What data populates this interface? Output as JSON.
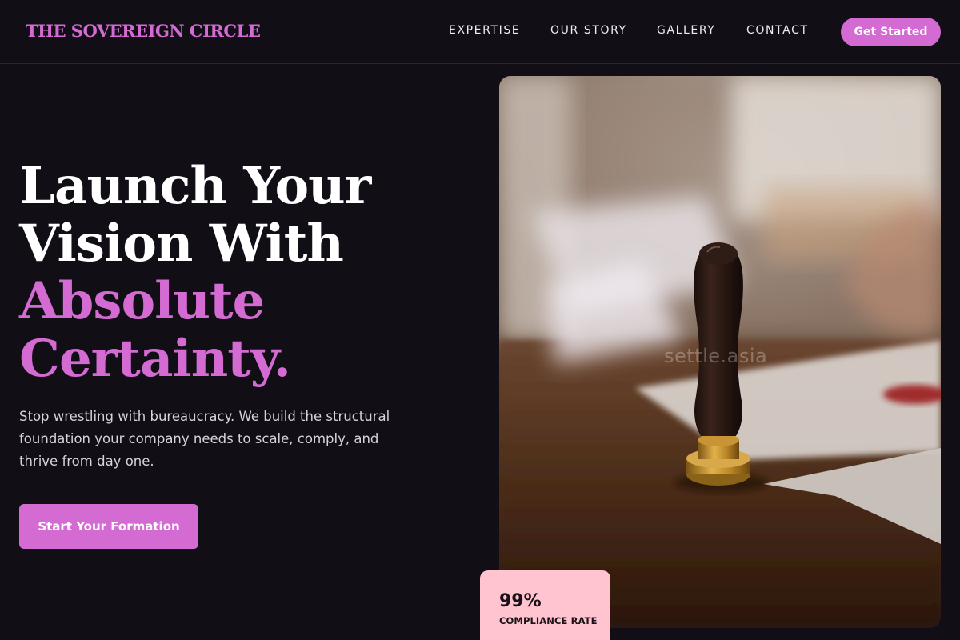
{
  "header": {
    "brand": "THE SOVEREIGN CIRCLE",
    "nav": [
      "EXPERTISE",
      "OUR STORY",
      "GALLERY",
      "CONTACT"
    ],
    "cta_label": "Get Started"
  },
  "hero": {
    "headline_line1": "Launch Your",
    "headline_line2": "Vision With",
    "headline_accent1": "Absolute",
    "headline_accent2": "Certainty.",
    "subtext": "Stop wrestling with bureaucracy. We build the structural foundation your company needs to scale, comply, and thrive from day one.",
    "cta_label": "Start Your Formation"
  },
  "photo": {
    "watermark": "settle.asia"
  },
  "stat": {
    "value": "99%",
    "label": "COMPLIANCE RATE"
  },
  "colors": {
    "accent": "#d46bd3",
    "background": "#120e16",
    "stat_card": "#ffc4d0"
  }
}
